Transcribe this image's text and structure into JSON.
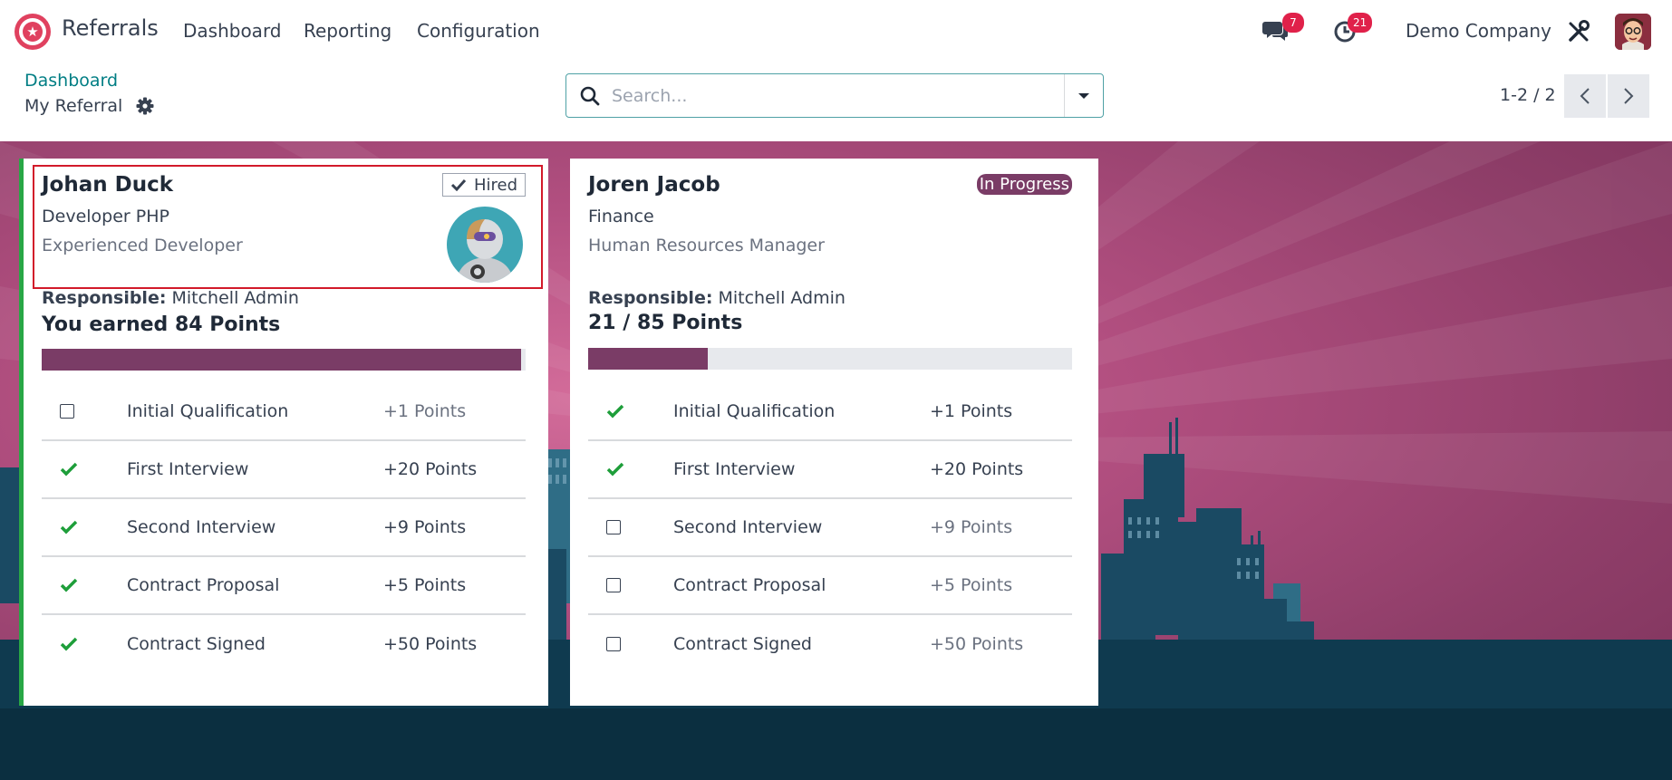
{
  "navbar": {
    "app_name": "Referrals",
    "menu": [
      "Dashboard",
      "Reporting",
      "Configuration"
    ],
    "messages_count": "7",
    "activities_count": "21",
    "company": "Demo Company"
  },
  "control_panel": {
    "breadcrumb": "Dashboard",
    "title": "My Referral",
    "search_placeholder": "Search...",
    "pager": "1-2 / 2"
  },
  "cards": [
    {
      "name": "Johan Duck",
      "department": "Developer PHP",
      "job": "Experienced Developer",
      "status": "Hired",
      "responsible_label": "Responsible:",
      "responsible": "Mitchell Admin",
      "points_text": "You earned 84 Points",
      "progress": 0.99,
      "stages": [
        {
          "label": "Initial Qualification",
          "points": "+1 Points",
          "done": false
        },
        {
          "label": "First Interview",
          "points": "+20 Points",
          "done": true
        },
        {
          "label": "Second Interview",
          "points": "+9 Points",
          "done": true
        },
        {
          "label": "Contract Proposal",
          "points": "+5 Points",
          "done": true
        },
        {
          "label": "Contract Signed",
          "points": "+50 Points",
          "done": true
        }
      ]
    },
    {
      "name": "Joren Jacob",
      "department": "Finance",
      "job": "Human Resources Manager",
      "status": "In Progress",
      "responsible_label": "Responsible:",
      "responsible": "Mitchell Admin",
      "points_text": "21 / 85 Points",
      "progress": 0.247,
      "stages": [
        {
          "label": "Initial Qualification",
          "points": "+1 Points",
          "done": true
        },
        {
          "label": "First Interview",
          "points": "+20 Points",
          "done": true
        },
        {
          "label": "Second Interview",
          "points": "+9 Points",
          "done": false
        },
        {
          "label": "Contract Proposal",
          "points": "+5 Points",
          "done": false
        },
        {
          "label": "Contract Signed",
          "points": "+50 Points",
          "done": false
        }
      ]
    }
  ],
  "colors": {
    "accent": "#017e84",
    "primary": "#7a3c66",
    "success": "#28a745",
    "badge": "#e0214a",
    "highlight": "#d21a2a"
  }
}
